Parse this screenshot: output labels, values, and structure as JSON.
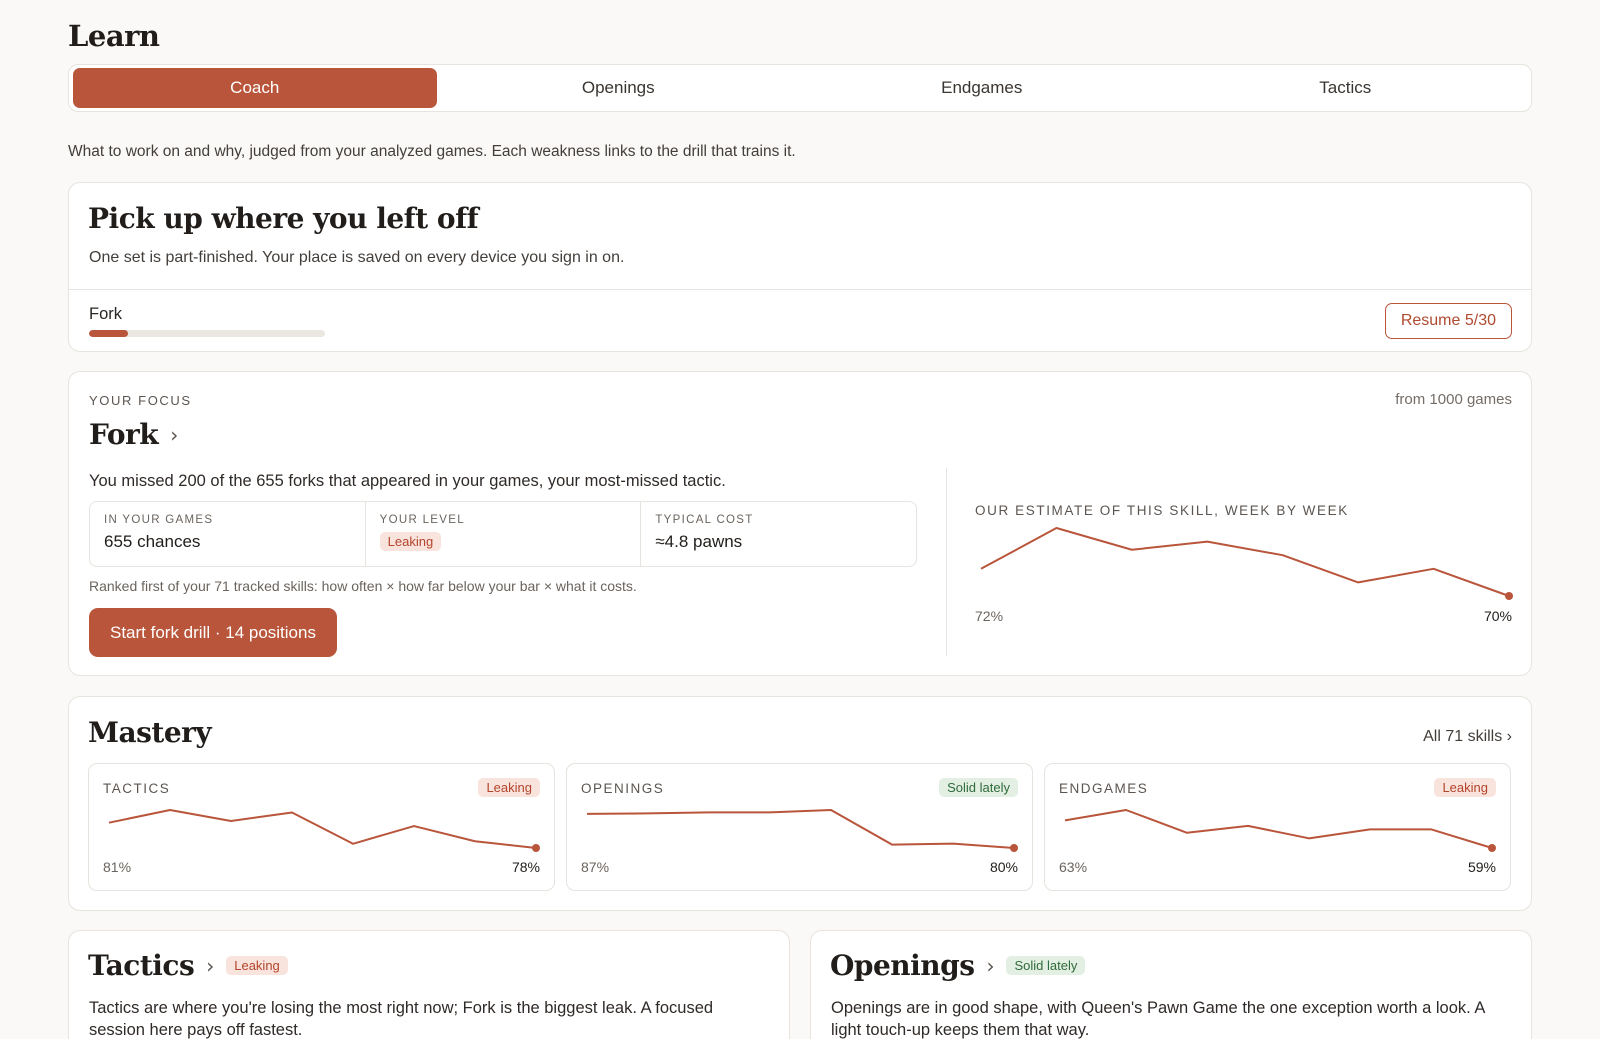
{
  "page": {
    "title": "Learn"
  },
  "tabs": [
    {
      "label": "Coach",
      "active": true
    },
    {
      "label": "Openings",
      "active": false
    },
    {
      "label": "Endgames",
      "active": false
    },
    {
      "label": "Tactics",
      "active": false
    }
  ],
  "intro": "What to work on and why, judged from your analyzed games. Each weakness links to the drill that trains it.",
  "resume": {
    "title": "Pick up where you left off",
    "subtitle": "One set is part-finished. Your place is saved on every device you sign in on.",
    "set_name": "Fork",
    "progress": 0.1667,
    "button": "Resume 5/30"
  },
  "focus": {
    "eyebrow": "YOUR FOCUS",
    "source": "from 1000 games",
    "title": "Fork",
    "description": "You missed 200 of the 655 forks that appeared in your games, your most-missed tactic.",
    "stats": [
      {
        "label": "IN YOUR GAMES",
        "value": "655 chances"
      },
      {
        "label": "YOUR LEVEL",
        "badge": "Leaking"
      },
      {
        "label": "TYPICAL COST",
        "value": "≈4.8 pawns"
      }
    ],
    "rank_note": "Ranked first of your 71 tracked skills: how often × how far below your bar × what it costs.",
    "drill_button": "Start fork drill · 14 positions",
    "trend": {
      "label": "OUR ESTIMATE OF THIS SKILL, WEEK BY WEEK",
      "start_label": "72%",
      "end_label": "70%",
      "values": [
        72,
        75,
        73.4,
        74,
        73,
        71,
        72,
        70
      ]
    }
  },
  "mastery": {
    "title": "Mastery",
    "all_link": "All 71 skills ›",
    "tiles": [
      {
        "label": "TACTICS",
        "badge": "Leaking",
        "status": "leak",
        "start_label": "81%",
        "end_label": "78%",
        "values": [
          81,
          82.5,
          81.2,
          82.2,
          78.5,
          80.6,
          78.8,
          78
        ]
      },
      {
        "label": "OPENINGS",
        "badge": "Solid lately",
        "status": "solid",
        "start_label": "87%",
        "end_label": "80%",
        "values": [
          87,
          87.1,
          87.3,
          87.3,
          87.8,
          80.7,
          80.9,
          80
        ]
      },
      {
        "label": "ENDGAMES",
        "badge": "Leaking",
        "status": "leak",
        "start_label": "63%",
        "end_label": "59%",
        "values": [
          63,
          64.5,
          61.2,
          62.2,
          60.4,
          61.7,
          61.7,
          59
        ]
      }
    ]
  },
  "sections": [
    {
      "title": "Tactics",
      "badge": "Leaking",
      "status": "leak",
      "body": "Tactics are where you're losing the most right now; Fork is the biggest leak. A focused session here pays off fastest."
    },
    {
      "title": "Openings",
      "badge": "Solid lately",
      "status": "solid",
      "body": "Openings are in good shape, with Queen's Pawn Game the one exception worth a look. A light touch-up keeps them that way."
    }
  ],
  "colors": {
    "accent": "#b9553b",
    "leak_bg": "#f8e3dd",
    "leak_fg": "#b5442c",
    "solid_bg": "#e3efe3",
    "solid_fg": "#2f6a3a",
    "line": "#b9553b"
  }
}
